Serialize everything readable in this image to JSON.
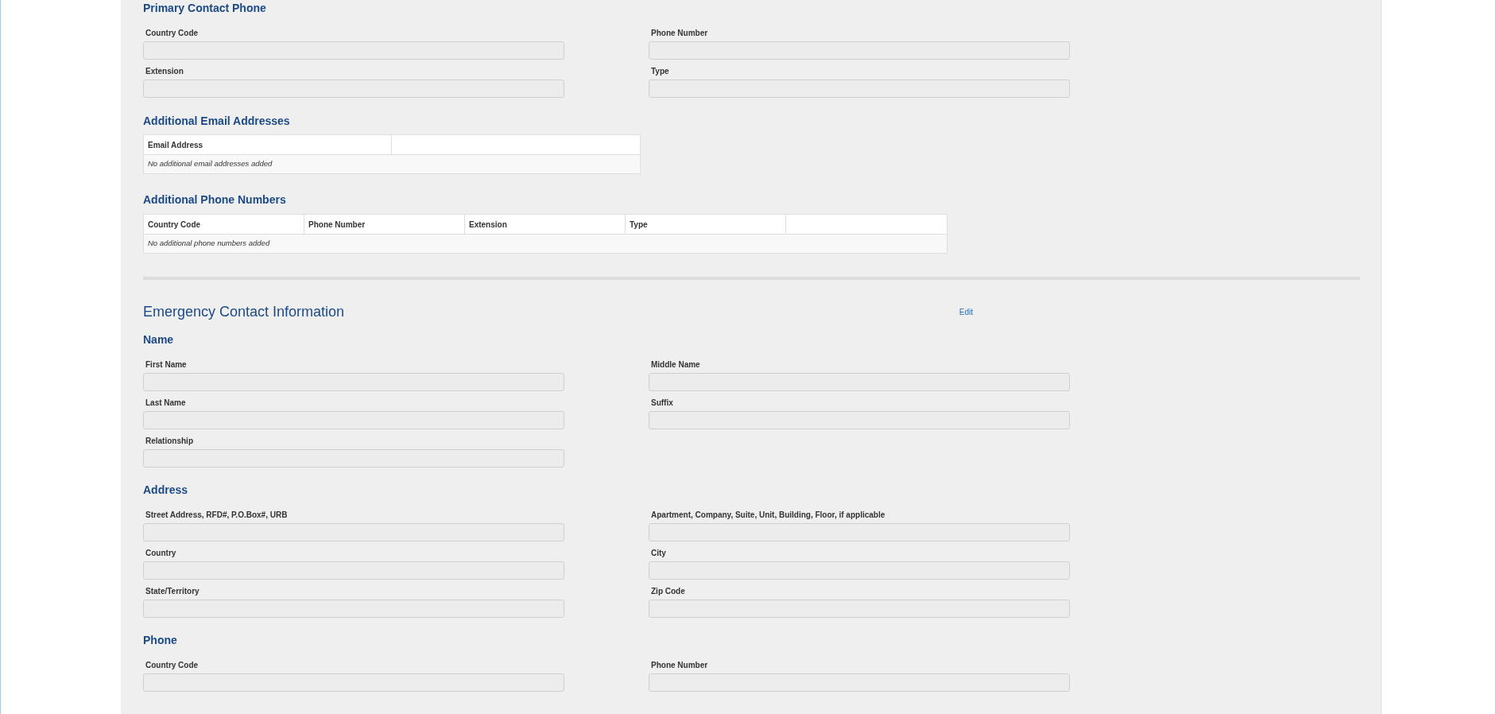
{
  "primary_phone": {
    "heading": "Primary Contact Phone",
    "rows": [
      [
        {
          "label": "Country Code"
        },
        {
          "label": "Phone Number"
        }
      ],
      [
        {
          "label": "Extension"
        },
        {
          "label": "Type"
        }
      ]
    ]
  },
  "email_table": {
    "heading": "Additional Email Addresses",
    "columns": [
      "Email Address"
    ],
    "empty_text": "No additional email addresses added"
  },
  "phone_table": {
    "heading": "Additional Phone Numbers",
    "columns": [
      "Country Code",
      "Phone Number",
      "Extension",
      "Type"
    ],
    "empty_text": "No additional phone numbers added"
  },
  "emergency": {
    "title": "Emergency Contact Information",
    "edit_link": "Edit",
    "sections": [
      {
        "heading": "Name",
        "rows": [
          [
            {
              "label": "First Name"
            },
            {
              "label": "Middle Name"
            }
          ],
          [
            {
              "label": "Last Name"
            },
            {
              "label": "Suffix"
            }
          ],
          [
            {
              "label": "Relationship"
            }
          ]
        ]
      },
      {
        "heading": "Address",
        "rows": [
          [
            {
              "label": "Street Address, RFD#, P.O.Box#, URB"
            },
            {
              "label": "Apartment, Company, Suite, Unit, Building, Floor, if applicable"
            }
          ],
          [
            {
              "label": "Country"
            },
            {
              "label": "City"
            }
          ],
          [
            {
              "label": "State/Territory"
            },
            {
              "label": "Zip Code"
            }
          ]
        ]
      },
      {
        "heading": "Phone",
        "rows": [
          [
            {
              "label": "Country Code"
            },
            {
              "label": "Phone Number"
            }
          ]
        ]
      }
    ]
  }
}
